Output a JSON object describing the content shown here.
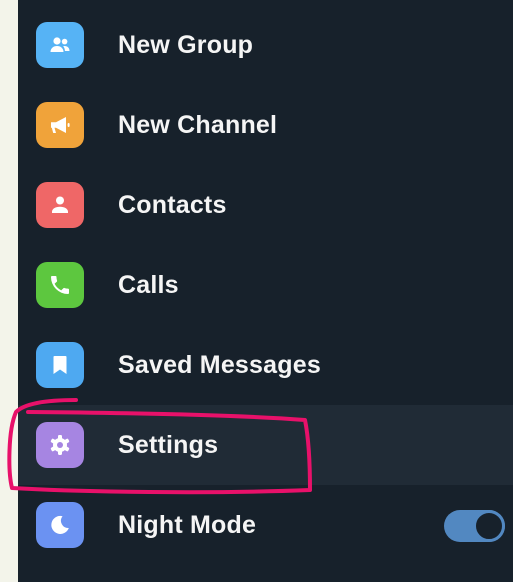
{
  "menu": {
    "items": [
      {
        "label": "New Group",
        "icon": "group-icon",
        "color": "#56b3f5"
      },
      {
        "label": "New Channel",
        "icon": "megaphone-icon",
        "color": "#f0a33a"
      },
      {
        "label": "Contacts",
        "icon": "person-icon",
        "color": "#ef6767"
      },
      {
        "label": "Calls",
        "icon": "phone-icon",
        "color": "#5dc73f"
      },
      {
        "label": "Saved Messages",
        "icon": "bookmark-icon",
        "color": "#4ea9f1"
      },
      {
        "label": "Settings",
        "icon": "gear-icon",
        "color": "#a685e2"
      },
      {
        "label": "Night Mode",
        "icon": "moon-icon",
        "color": "#6b92f2"
      }
    ]
  },
  "night_mode": {
    "enabled": true
  },
  "colors": {
    "panel_background": "#17212b",
    "highlight_background": "#202b36",
    "toggle_on": "#5288c1",
    "annotation_stroke": "#e8116a"
  }
}
